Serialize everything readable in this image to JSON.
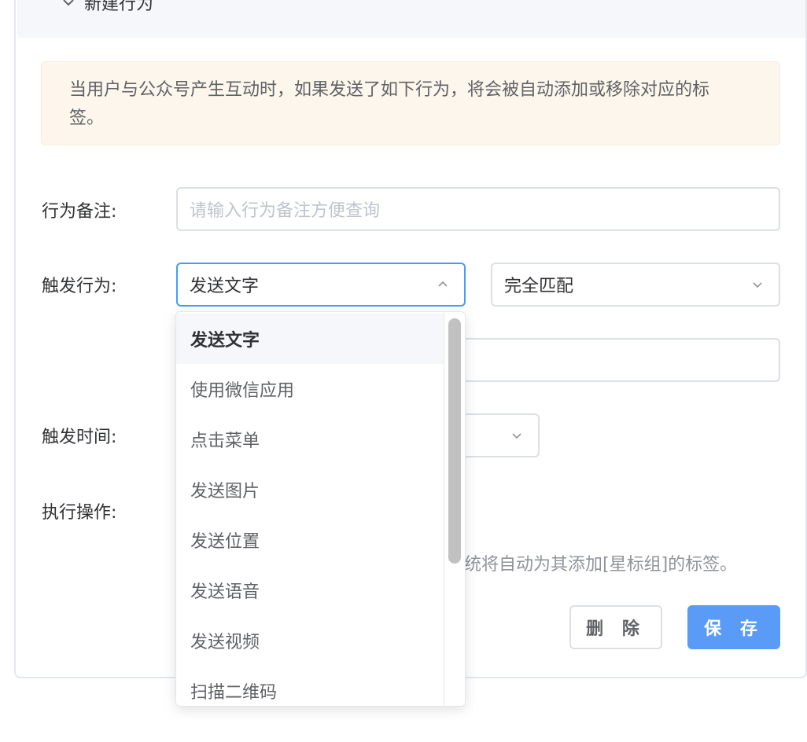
{
  "header": {
    "title": "新建行为",
    "icon": "chevron-down-icon"
  },
  "alert": {
    "text": "当用户与公众号产生互动时，如果发送了如下行为，将会被自动添加或移除对应的标签。"
  },
  "form": {
    "remark": {
      "label": "行为备注:",
      "placeholder": "请输入行为备注方便查询",
      "value": ""
    },
    "trigger": {
      "label": "触发行为:",
      "action_value": "发送文字",
      "match_value": "完全匹配",
      "keyword_value": ""
    },
    "time": {
      "label": "触发时间:",
      "value": ""
    },
    "operation": {
      "label": "执行操作:",
      "hint": "统将自动为其添加[星标组]的标签。"
    }
  },
  "buttons": {
    "delete": "删 除",
    "save": "保 存"
  },
  "dropdown": {
    "options": [
      "发送文字",
      "使用微信应用",
      "点击菜单",
      "发送图片",
      "发送位置",
      "发送语音",
      "发送视频",
      "扫描二维码"
    ],
    "selected_index": 0
  },
  "colors": {
    "primary": "#409eff",
    "save_button": "#5b9bf8",
    "alert_bg": "#fdf6ec",
    "border": "#dcdfe6"
  }
}
